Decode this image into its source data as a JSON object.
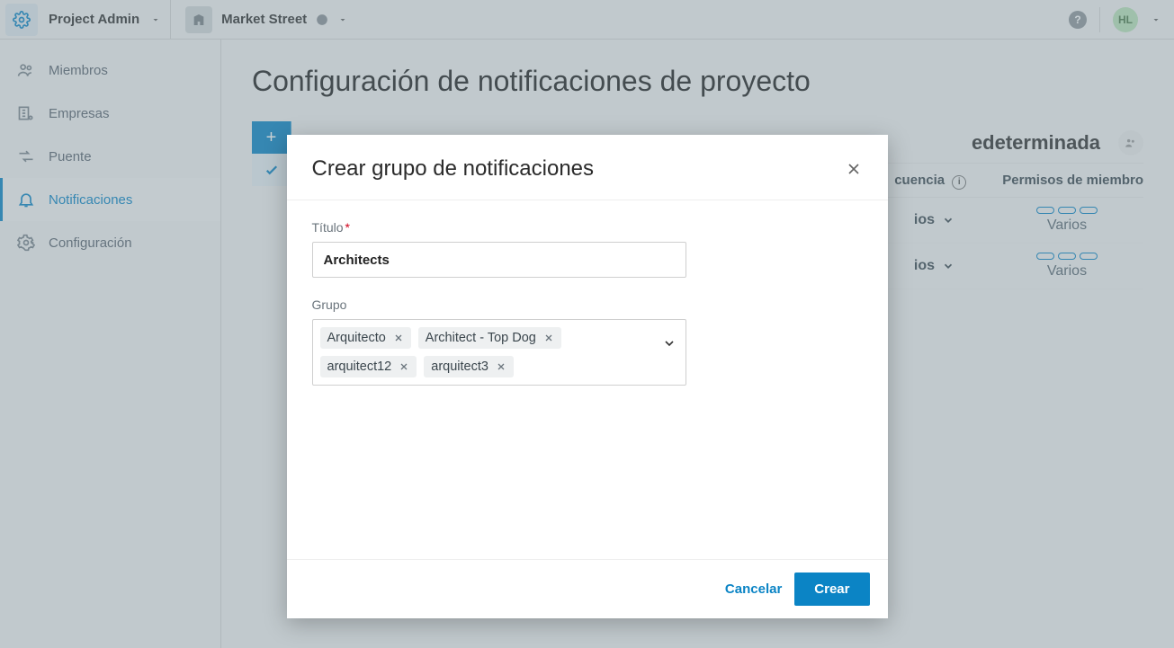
{
  "topbar": {
    "app_title": "Project Admin",
    "project_name": "Market Street",
    "avatar_initials": "HL"
  },
  "sidebar": {
    "items": [
      {
        "label": "Miembros"
      },
      {
        "label": "Empresas"
      },
      {
        "label": "Puente"
      },
      {
        "label": "Notificaciones"
      },
      {
        "label": "Configuración"
      }
    ]
  },
  "main": {
    "heading": "Configuración de notificaciones de proyecto",
    "heading_right": "edeterminada",
    "columns": {
      "frequency": "cuencia",
      "permissions": "Permisos de miembro"
    },
    "rows": [
      {
        "freq": "ios",
        "perm": "Varios"
      },
      {
        "freq": "ios",
        "perm": "Varios"
      }
    ]
  },
  "modal": {
    "title": "Crear grupo de notificaciones",
    "label_title": "Título",
    "value_title": "Architects",
    "label_group": "Grupo",
    "chips": [
      "Arquitecto",
      "Architect - Top Dog",
      "arquitect12",
      "arquitect3"
    ],
    "cancel": "Cancelar",
    "submit": "Crear"
  }
}
